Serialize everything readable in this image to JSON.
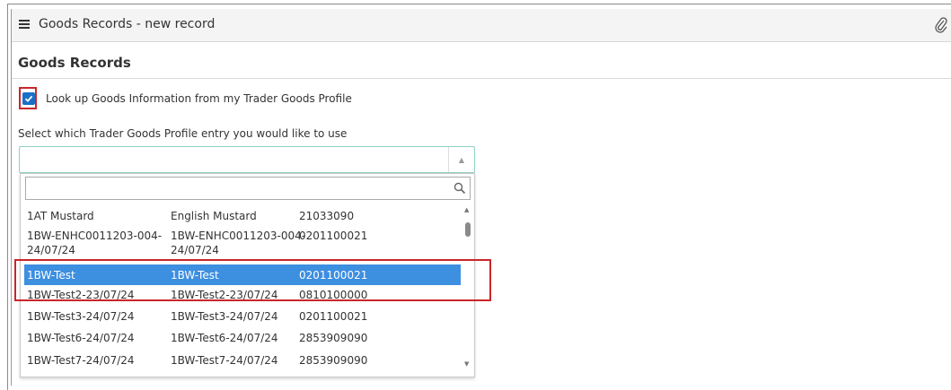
{
  "window": {
    "title": "Goods Records - new record"
  },
  "section": {
    "title": "Goods Records"
  },
  "lookup": {
    "label": "Look up Goods Information from my Trader Goods Profile",
    "checked": true
  },
  "select": {
    "label": "Select which Trader Goods Profile entry you would like to use",
    "value": ""
  },
  "search": {
    "placeholder": ""
  },
  "rows": [
    {
      "ref": "1AT Mustard",
      "desc": "English Mustard",
      "code": "21033090"
    },
    {
      "ref": "1BW-ENHC0011203-004-\n24/07/24",
      "desc": "1BW-ENHC0011203-004-\n24/07/24",
      "code": "0201100021"
    },
    {
      "ref": "1BW-Test",
      "desc": "1BW-Test",
      "code": "0201100021"
    },
    {
      "ref": "1BW-Test2-23/07/24",
      "desc": "1BW-Test2-23/07/24",
      "code": "0810100000"
    },
    {
      "ref": "1BW-Test3-24/07/24",
      "desc": "1BW-Test3-24/07/24",
      "code": "0201100021"
    },
    {
      "ref": "1BW-Test6-24/07/24",
      "desc": "1BW-Test6-24/07/24",
      "code": "2853909090"
    },
    {
      "ref": "1BW-Test7-24/07/24",
      "desc": "1BW-Test7-24/07/24",
      "code": "2853909090"
    }
  ],
  "colors": {
    "accent": "#1a6fc7",
    "selection": "#3d8fe0",
    "highlight": "#c9262c"
  },
  "icons": {
    "menu": "hamburger-icon",
    "attach": "paperclip-icon",
    "search": "search-icon"
  }
}
